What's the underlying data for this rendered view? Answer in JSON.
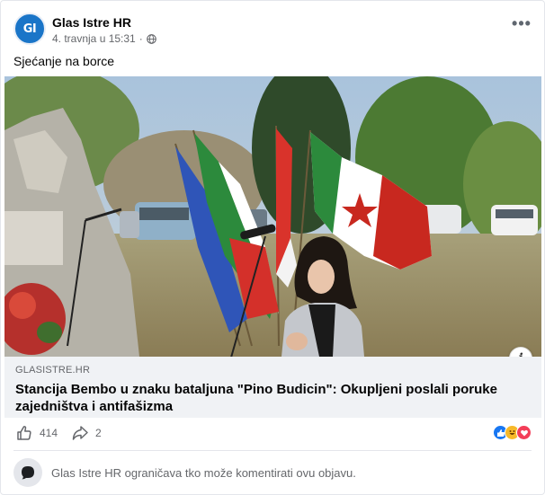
{
  "post": {
    "page_name": "Glas Istre HR",
    "avatar_text": "GI",
    "timestamp": "4. travnja u 15:31",
    "separator": "·",
    "more_label": "•••",
    "text": "Sjećanje na borce"
  },
  "link": {
    "domain": "GLASISTRE.HR",
    "title": "Stancija Bembo u znaku bataljuna \"Pino Budicin\": Okupljeni poslali poruke zajedništva i antifašizma",
    "info_label": "i"
  },
  "footer": {
    "likes": "414",
    "shares": "2",
    "comment_notice": "Glas Istre HR ograničava tko može komentirati ovu objavu."
  },
  "colors": {
    "brand": "#1a75c8",
    "like": "#1877f2",
    "haha": "#f7b928",
    "love": "#f33e58"
  },
  "icons": {
    "globe": "globe-icon",
    "more": "more-options-icon",
    "like": "thumbs-up-icon",
    "share": "share-arrow-icon",
    "info": "info-icon"
  }
}
